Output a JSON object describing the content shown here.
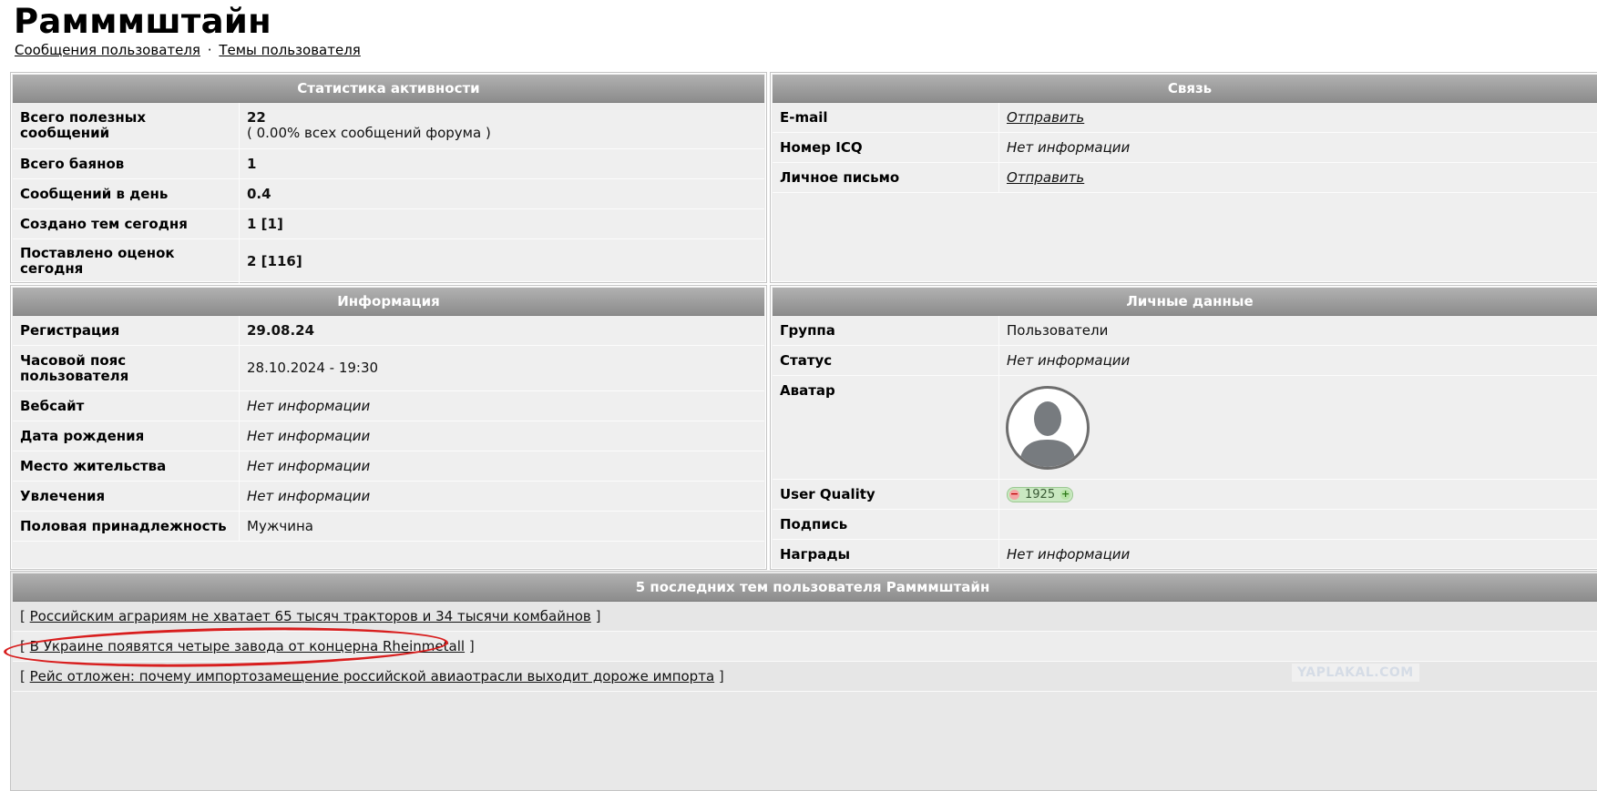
{
  "page": {
    "title": "Рамммштайн",
    "links": {
      "posts": "Сообщения пользователя",
      "sep": "·",
      "topics": "Темы пользователя"
    }
  },
  "activity": {
    "header": "Статистика активности",
    "rows": [
      {
        "label": "Всего полезных сообщений",
        "value": "22",
        "sub": "( 0.00% всех сообщений форума )"
      },
      {
        "label": "Всего баянов",
        "value": "1"
      },
      {
        "label": "Сообщений в день",
        "value": "0.4"
      },
      {
        "label": "Создано тем сегодня",
        "value": "1 [1]"
      },
      {
        "label": "Поставлено оценок сегодня",
        "value": "2 [116]"
      }
    ]
  },
  "contact": {
    "header": "Связь",
    "rows": [
      {
        "label": "E-mail",
        "value": "Отправить"
      },
      {
        "label": "Номер ICQ",
        "value": "Нет информации"
      },
      {
        "label": "Личное письмо",
        "value": "Отправить"
      }
    ]
  },
  "info": {
    "header": "Информация",
    "rows": [
      {
        "label": "Регистрация",
        "value": "29.08.24"
      },
      {
        "label": "Часовой пояс пользователя",
        "value": "28.10.2024 - 19:30"
      },
      {
        "label": "Вебсайт",
        "value": "Нет информации"
      },
      {
        "label": "Дата рождения",
        "value": "Нет информации"
      },
      {
        "label": "Место жительства",
        "value": "Нет информации"
      },
      {
        "label": "Увлечения",
        "value": "Нет информации"
      },
      {
        "label": "Половая принадлежность",
        "value": "Мужчина"
      }
    ]
  },
  "personal": {
    "header": "Личные данные",
    "rows": [
      {
        "label": "Группа",
        "value": "Пользователи"
      },
      {
        "label": "Статус",
        "value": "Нет информации"
      },
      {
        "label": "Аватар",
        "value": ""
      },
      {
        "label": "User Quality",
        "value": "1925"
      },
      {
        "label": "Подпись",
        "value": ""
      },
      {
        "label": "Награды",
        "value": "Нет информации"
      }
    ],
    "uq_minus": "−",
    "uq_plus": "+"
  },
  "recent": {
    "header": "5 последних тем пользователя Рамммштайн",
    "open_bracket": "[",
    "close_bracket": "]",
    "topics": [
      "Российским аграриям не хватает 65 тысяч тракторов и 34 тысячи комбайнов",
      "В Украине появятся четыре завода от концерна Rheinmetall",
      "Рейс отложен: почему импортозамещение российской авиаотрасли выходит дороже импорта"
    ]
  },
  "watermark": "YAPLAKAL.COM",
  "colors": {
    "highlight": "#d81e1e",
    "header_bg": "#9e9e9e",
    "panel_bg": "#efefef"
  }
}
